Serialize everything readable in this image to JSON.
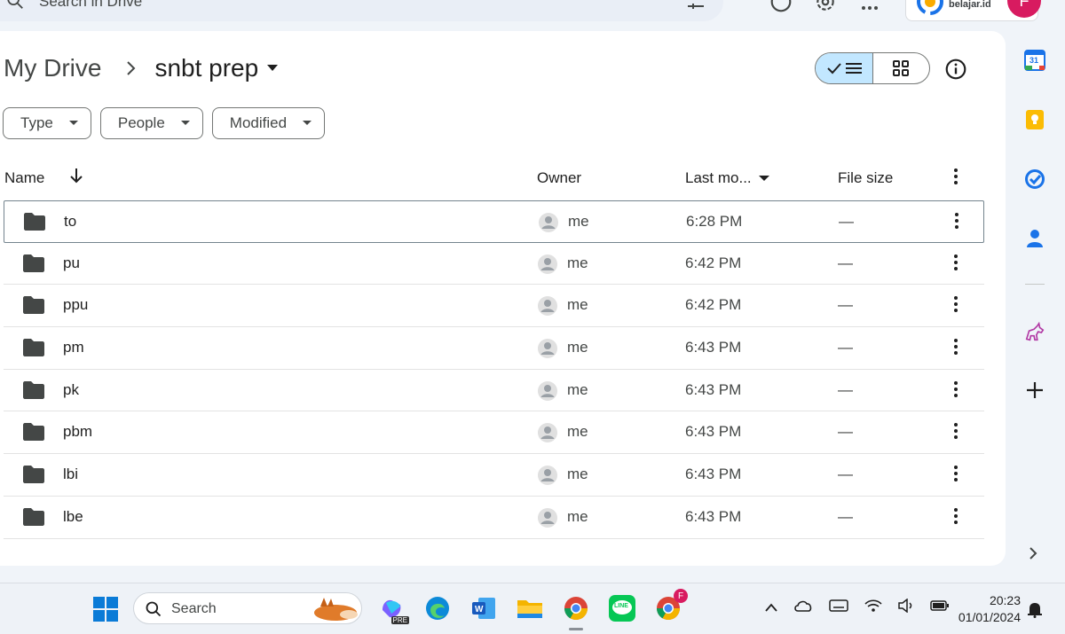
{
  "colors": {
    "background": "#f0f4f9",
    "card": "#ffffff",
    "toggle_active": "#c2e7ff",
    "folder": "#444746",
    "avatar": "#d81b60"
  },
  "top_bar": {
    "search_placeholder": "Search in Drive",
    "org_label": "belajar.id",
    "avatar_initial": "F"
  },
  "breadcrumb": {
    "root": "My Drive",
    "current": "snbt prep"
  },
  "filters": [
    {
      "label": "Type"
    },
    {
      "label": "People"
    },
    {
      "label": "Modified"
    }
  ],
  "columns": {
    "name": "Name",
    "owner": "Owner",
    "last_modified": "Last mo...",
    "file_size": "File size"
  },
  "rows": [
    {
      "name": "to",
      "owner": "me",
      "modified": "6:28 PM",
      "size": "—"
    },
    {
      "name": "pu",
      "owner": "me",
      "modified": "6:42 PM",
      "size": "—"
    },
    {
      "name": "ppu",
      "owner": "me",
      "modified": "6:42 PM",
      "size": "—"
    },
    {
      "name": "pm",
      "owner": "me",
      "modified": "6:43 PM",
      "size": "—"
    },
    {
      "name": "pk",
      "owner": "me",
      "modified": "6:43 PM",
      "size": "—"
    },
    {
      "name": "pbm",
      "owner": "me",
      "modified": "6:43 PM",
      "size": "—"
    },
    {
      "name": "lbi",
      "owner": "me",
      "modified": "6:43 PM",
      "size": "—"
    },
    {
      "name": "lbe",
      "owner": "me",
      "modified": "6:43 PM",
      "size": "—"
    }
  ],
  "side_panel": {
    "calendar_day": "31"
  },
  "taskbar": {
    "search_label": "Search",
    "copilot_badge": "PRE",
    "line_label": "LINE",
    "chrome_profile_badge": "F",
    "time": "20:23",
    "date": "01/01/2024"
  }
}
